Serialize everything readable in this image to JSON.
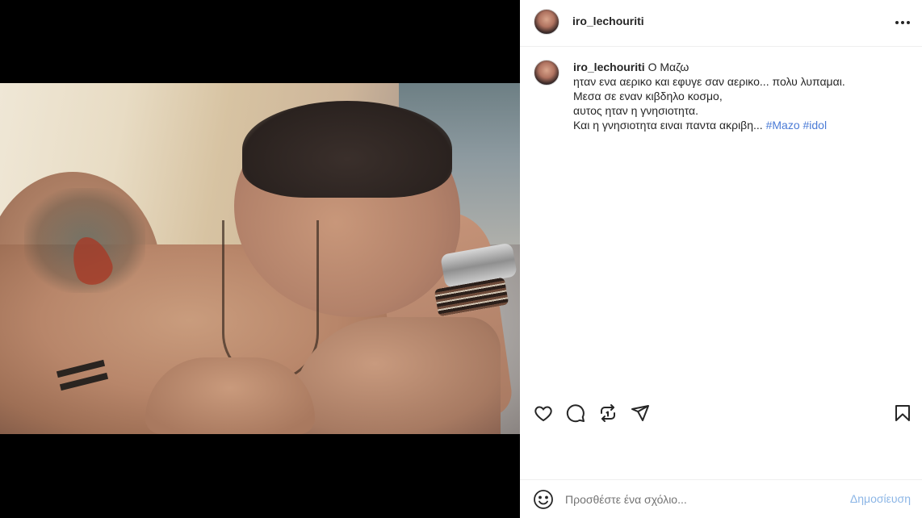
{
  "post": {
    "media_alt": "",
    "author": "iro_lechouriti"
  },
  "header": {
    "username": "iro_lechouriti",
    "more_icon": "more-horizontal-icon"
  },
  "caption": {
    "username": "iro_lechouriti",
    "lines": [
      "Ο Μαζω",
      "ηταν ενα αερικο και εφυγε σαν αερικο... πολυ λυπαμαι.",
      "Μεσα σε εναν κιβδηλο κοσμο,",
      "αυτος ηταν η γνησιοτητα.",
      "Και η γνησιοτητα ειναι παντα ακριβη..."
    ],
    "hashtags": [
      "#Mazo",
      "#idol"
    ]
  },
  "actions": {
    "icons": [
      "heart-icon",
      "comment-icon",
      "repost-icon",
      "share-icon",
      "bookmark-icon"
    ]
  },
  "comment": {
    "placeholder": "Προσθέστε ένα σχόλιο...",
    "post_label": "Δημοσίευση",
    "emoji_icon": "emoji-icon"
  },
  "colors": {
    "hashtag": "#4b7bd6",
    "post_button": "#8cb6e6",
    "divider": "#efefef"
  }
}
